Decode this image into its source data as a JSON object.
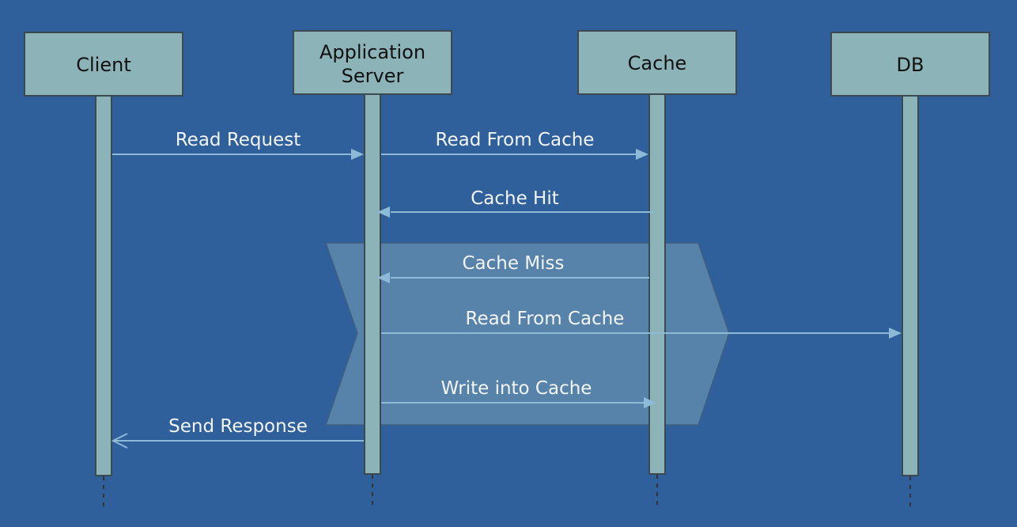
{
  "colors": {
    "background": "#2F609C",
    "participant": "#8CB3B8",
    "arrow": "#8DBAD6",
    "fragment": "#5783AA"
  },
  "participants": [
    {
      "name": "Client"
    },
    {
      "name": "Application Server",
      "lines": [
        "Application",
        "Server"
      ]
    },
    {
      "name": "Cache"
    },
    {
      "name": "DB"
    }
  ],
  "messages": [
    {
      "label": "Read Request",
      "from": "Client",
      "to": "Application Server",
      "arrow": "filled"
    },
    {
      "label": "Read From Cache",
      "from": "Application Server",
      "to": "Cache",
      "arrow": "filled"
    },
    {
      "label": "Cache Hit",
      "from": "Cache",
      "to": "Application Server",
      "arrow": "filled"
    },
    {
      "label": "Cache Miss",
      "from": "Cache",
      "to": "Application Server",
      "arrow": "filled"
    },
    {
      "label": "Read From Cache",
      "from": "Application Server",
      "to": "DB",
      "arrow": "filled"
    },
    {
      "label": "Write into Cache",
      "from": "Application Server",
      "to": "Cache",
      "arrow": "filled"
    },
    {
      "label": "Send Response",
      "from": "Application Server",
      "to": "Client",
      "arrow": "open"
    }
  ]
}
